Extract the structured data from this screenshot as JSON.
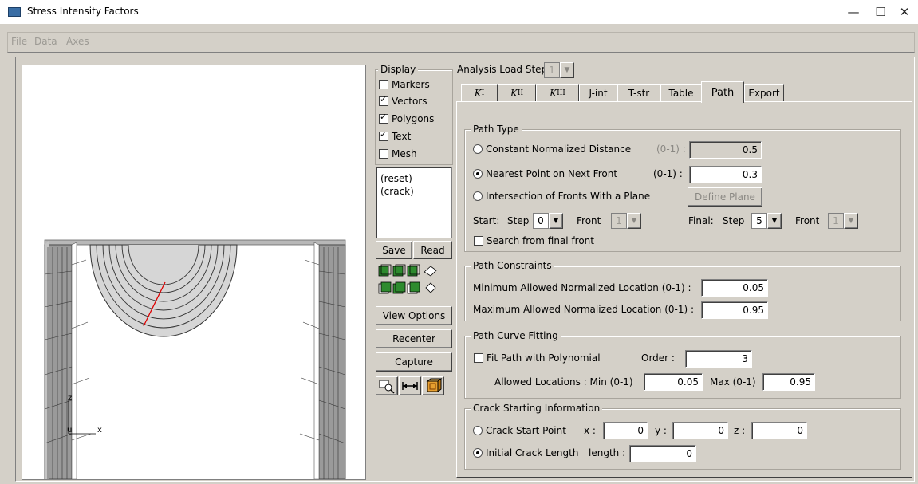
{
  "window": {
    "title": "Stress Intensity Factors",
    "minimize": "—",
    "maximize": "☐",
    "close": "✕"
  },
  "menu": {
    "file": "File",
    "data": "Data",
    "axes": "Axes"
  },
  "display": {
    "title": "Display",
    "markers": "Markers",
    "vectors": "Vectors",
    "polygons": "Polygons",
    "text": "Text",
    "mesh": "Mesh"
  },
  "views": {
    "items": [
      "(reset)",
      "(crack)"
    ]
  },
  "buttons": {
    "save": "Save",
    "read": "Read",
    "view_options": "View Options",
    "recenter": "Recenter",
    "capture": "Capture"
  },
  "axes": {
    "z": "z",
    "u": "u",
    "x": "x"
  },
  "load_step": {
    "label": "Analysis Load Step",
    "value": "1"
  },
  "tabs": {
    "k1": "K",
    "k1_sub": "I",
    "k2": "K",
    "k2_sub": "II",
    "k3": "K",
    "k3_sub": "III",
    "jint": "J-int",
    "tstr": "T-str",
    "table": "Table",
    "path": "Path",
    "export": "Export"
  },
  "path_type": {
    "title": "Path Type",
    "constant_label": "Constant Normalized Distance",
    "constant_range": "(0-1) :",
    "constant_value": "0.5",
    "nearest_label": "Nearest Point on Next Front",
    "nearest_range": "(0-1) :",
    "nearest_value": "0.3",
    "intersection_label": "Intersection of Fronts With a Plane",
    "define_plane": "Define Plane",
    "start_label": "Start:",
    "step_label": "Step",
    "start_step": "0",
    "front_label": "Front",
    "start_front": "1",
    "final_label": "Final:",
    "final_step_label": "Step",
    "final_step": "5",
    "final_front_label": "Front",
    "final_front": "1",
    "search_final": "Search from final front"
  },
  "constraints": {
    "title": "Path Constraints",
    "min_label": "Minimum Allowed Normalized Location  (0-1) :",
    "min_value": "0.05",
    "max_label": "Maximum Allowed Normalized Location (0-1) :",
    "max_value": "0.95"
  },
  "fitting": {
    "title": "Path Curve Fitting",
    "fit_label": "Fit Path with Polynomial",
    "order_label": "Order :",
    "order_value": "3",
    "allowed_label": "Allowed Locations :  Min (0-1)",
    "min_value": "0.05",
    "max_label": "Max (0-1)",
    "max_value": "0.95"
  },
  "crack_start": {
    "title": "Crack Starting Information",
    "point_label": "Crack Start Point",
    "x_label": "x :",
    "x_value": "0",
    "y_label": "y :",
    "y_value": "0",
    "z_label": "z :",
    "z_value": "0",
    "length_label": "Initial Crack Length",
    "length_sub": "length :",
    "length_value": "0"
  }
}
